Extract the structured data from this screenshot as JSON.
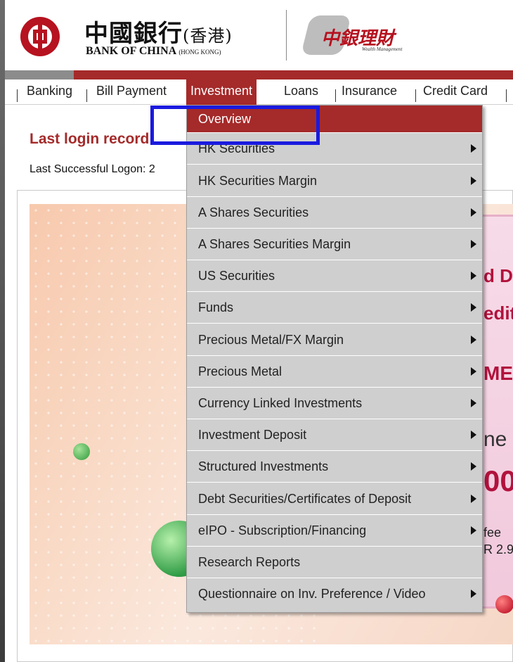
{
  "header": {
    "brand_cn": "中國銀行",
    "brand_cn_suffix": "(香港)",
    "brand_en": "BANK OF CHINA",
    "brand_en_suffix": "(HONG KONG)",
    "wm_logo_text": "中銀理財",
    "wm_logo_sub": "Wealth Management"
  },
  "nav": {
    "items": [
      {
        "label": "Banking"
      },
      {
        "label": "Bill Payment"
      },
      {
        "label": "Investment"
      },
      {
        "label": "Loans"
      },
      {
        "label": "Insurance"
      },
      {
        "label": "Credit Card"
      }
    ],
    "active": "Investment"
  },
  "login": {
    "title": "Last login record",
    "line": "Last Successful Logon: 2"
  },
  "investment_menu": {
    "items": [
      {
        "label": "Overview",
        "has_submenu": false
      },
      {
        "label": "HK Securities",
        "has_submenu": true
      },
      {
        "label": "HK Securities Margin",
        "has_submenu": true
      },
      {
        "label": "A Shares Securities",
        "has_submenu": true
      },
      {
        "label": "A Shares Securities Margin",
        "has_submenu": true
      },
      {
        "label": "US Securities",
        "has_submenu": true
      },
      {
        "label": "Funds",
        "has_submenu": true
      },
      {
        "label": "Precious Metal/FX Margin",
        "has_submenu": true
      },
      {
        "label": "Precious Metal",
        "has_submenu": true
      },
      {
        "label": "Currency Linked Investments",
        "has_submenu": true
      },
      {
        "label": "Investment Deposit",
        "has_submenu": true
      },
      {
        "label": "Structured Investments",
        "has_submenu": true
      },
      {
        "label": "Debt Securities/Certificates of Deposit",
        "has_submenu": true
      },
      {
        "label": "eIPO - Subscription/Financing",
        "has_submenu": true
      },
      {
        "label": "Research Reports",
        "has_submenu": false
      },
      {
        "label": "Questionnaire on Inv. Preference / Video",
        "has_submenu": true
      }
    ],
    "selected": "Overview"
  },
  "banner": {
    "text_fragments": [
      "d D",
      "edit",
      "ME",
      "ne",
      "00",
      "fee",
      "R 2.9"
    ]
  },
  "colors": {
    "brand_red": "#a52a2a",
    "highlight_blue": "#1a1adf",
    "menu_gray": "#cfcfcf"
  }
}
